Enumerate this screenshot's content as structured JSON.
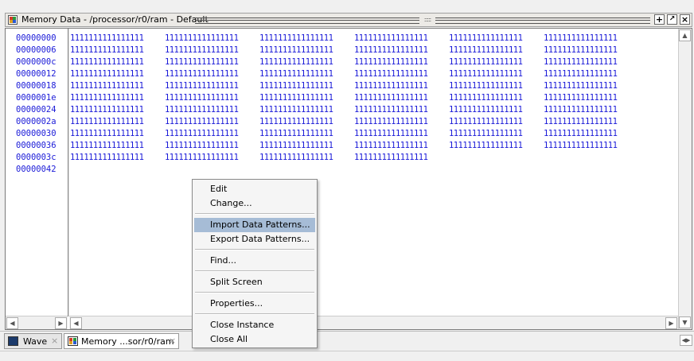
{
  "window": {
    "title": "Memory Data - /processor/r0/ram - Default",
    "buttons": {
      "zoom": "+",
      "undock": "↗",
      "close": "×"
    }
  },
  "memory": {
    "addresses": [
      "00000000",
      "00000006",
      "0000000c",
      "00000012",
      "00000018",
      "0000001e",
      "00000024",
      "0000002a",
      "00000030",
      "00000036",
      "0000003c",
      "00000042"
    ],
    "rows": [
      [
        "1111111111111111",
        "1111111111111111",
        "1111111111111111",
        "1111111111111111",
        "1111111111111111",
        "1111111111111111"
      ],
      [
        "1111111111111111",
        "1111111111111111",
        "1111111111111111",
        "1111111111111111",
        "1111111111111111",
        "1111111111111111"
      ],
      [
        "1111111111111111",
        "1111111111111111",
        "1111111111111111",
        "1111111111111111",
        "1111111111111111",
        "1111111111111111"
      ],
      [
        "1111111111111111",
        "1111111111111111",
        "1111111111111111",
        "1111111111111111",
        "1111111111111111",
        "1111111111111111"
      ],
      [
        "1111111111111111",
        "1111111111111111",
        "1111111111111111",
        "1111111111111111",
        "1111111111111111",
        "1111111111111111"
      ],
      [
        "1111111111111111",
        "1111111111111111",
        "1111111111111111",
        "1111111111111111",
        "1111111111111111",
        "1111111111111111"
      ],
      [
        "1111111111111111",
        "1111111111111111",
        "1111111111111111",
        "1111111111111111",
        "1111111111111111",
        "1111111111111111"
      ],
      [
        "1111111111111111",
        "1111111111111111",
        "1111111111111111",
        "1111111111111111",
        "1111111111111111",
        "1111111111111111"
      ],
      [
        "1111111111111111",
        "1111111111111111",
        "1111111111111111",
        "1111111111111111",
        "1111111111111111",
        "1111111111111111"
      ],
      [
        "1111111111111111",
        "1111111111111111",
        "1111111111111111",
        "1111111111111111",
        "1111111111111111",
        "1111111111111111"
      ],
      [
        "1111111111111111",
        "1111111111111111",
        "1111111111111111",
        "1111111111111111"
      ],
      []
    ],
    "value_color": "#1a1ad8"
  },
  "context_menu": {
    "items": [
      {
        "label": "Edit"
      },
      {
        "label": "Change..."
      },
      {
        "label": "Import Data Patterns...",
        "highlighted": true
      },
      {
        "label": "Export Data Patterns..."
      },
      {
        "label": "Find..."
      },
      {
        "label": "Split Screen"
      },
      {
        "label": "Properties..."
      },
      {
        "label": "Close Instance"
      },
      {
        "label": "Close All"
      }
    ],
    "highlight_color": "#a6bcd6"
  },
  "tabs": [
    {
      "label": "Wave",
      "close": "×",
      "icon": "wave-icon"
    },
    {
      "label": "Memory ...sor/r0/ram",
      "close": "×",
      "icon": "memory-icon",
      "active": true
    }
  ],
  "scroll_arrows": {
    "up": "▲",
    "down": "▼",
    "left": "◀",
    "right": "▶"
  }
}
